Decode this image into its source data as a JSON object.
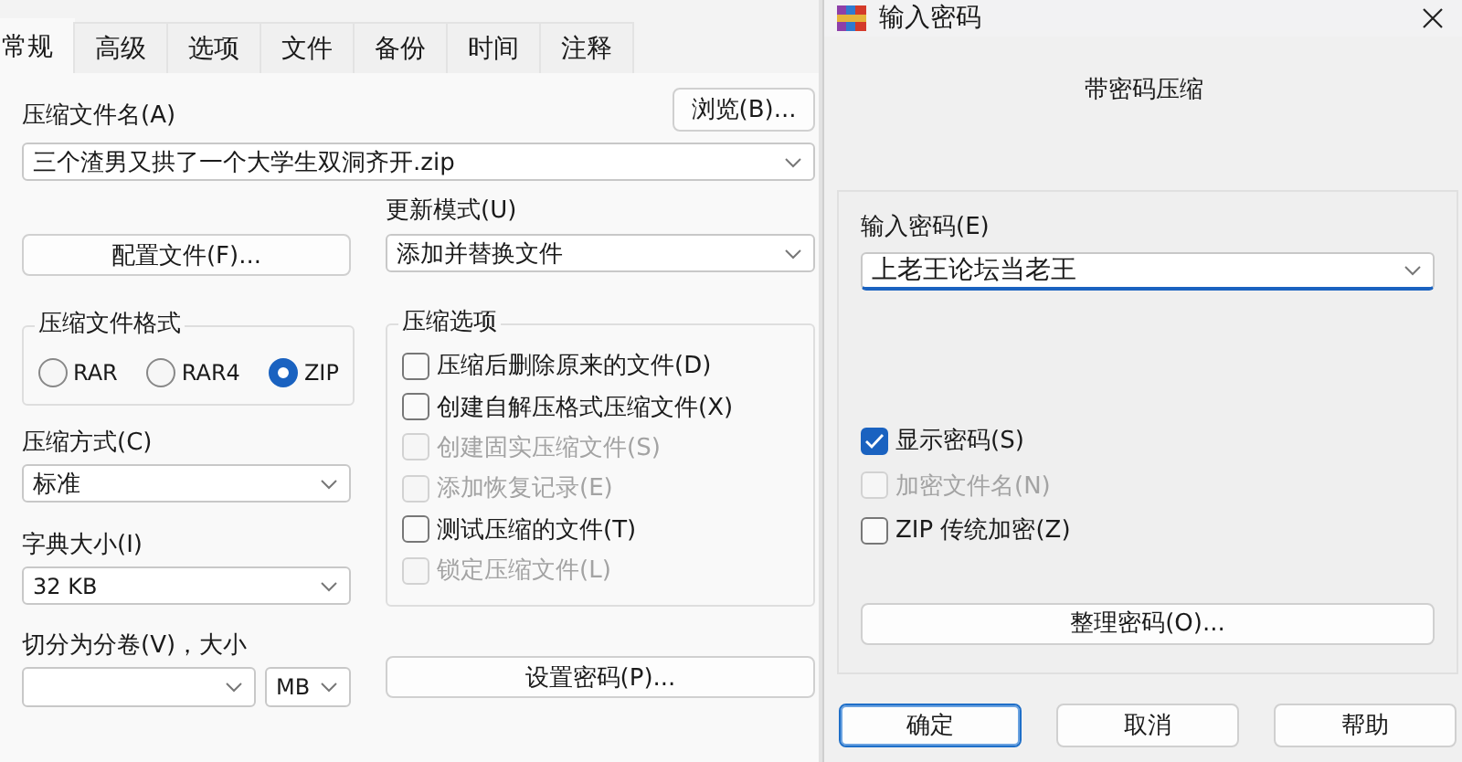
{
  "archive_dialog": {
    "tabs": [
      {
        "label": "常规",
        "selected": true
      },
      {
        "label": "高级",
        "selected": false
      },
      {
        "label": "选项",
        "selected": false
      },
      {
        "label": "文件",
        "selected": false
      },
      {
        "label": "备份",
        "selected": false
      },
      {
        "label": "时间",
        "selected": false
      },
      {
        "label": "注释",
        "selected": false
      }
    ],
    "archive_name": {
      "label": "压缩文件名(A)",
      "value": "三个渣男又拱了一个大学生双洞齐开.zip"
    },
    "browse_button": "浏览(B)...",
    "profiles_button": "配置文件(F)...",
    "update_mode": {
      "label": "更新模式(U)",
      "value": "添加并替换文件"
    },
    "archive_format": {
      "label": "压缩文件格式",
      "options": [
        {
          "label": "RAR",
          "selected": false
        },
        {
          "label": "RAR4",
          "selected": false
        },
        {
          "label": "ZIP",
          "selected": true
        }
      ]
    },
    "compression_method": {
      "label": "压缩方式(C)",
      "value": "标准"
    },
    "dictionary_size": {
      "label": "字典大小(I)",
      "value": "32 KB"
    },
    "split_volumes": {
      "label": "切分为分卷(V)，大小",
      "unit": "MB"
    },
    "archiving_options": {
      "label": "压缩选项",
      "options": [
        {
          "label": "压缩后删除原来的文件(D)",
          "checked": false,
          "disabled": false
        },
        {
          "label": "创建自解压格式压缩文件(X)",
          "checked": false,
          "disabled": false
        },
        {
          "label": "创建固实压缩文件(S)",
          "checked": false,
          "disabled": true
        },
        {
          "label": "添加恢复记录(E)",
          "checked": false,
          "disabled": true
        },
        {
          "label": "测试压缩的文件(T)",
          "checked": false,
          "disabled": false
        },
        {
          "label": "锁定压缩文件(L)",
          "checked": false,
          "disabled": true
        }
      ]
    },
    "set_password_button": "设置密码(P)..."
  },
  "password_dialog": {
    "title": "输入密码",
    "heading": "带密码压缩",
    "password": {
      "label": "输入密码(E)",
      "value": "上老王论坛当老王"
    },
    "options": [
      {
        "label": "显示密码(S)",
        "checked": true,
        "disabled": false
      },
      {
        "label": "加密文件名(N)",
        "checked": false,
        "disabled": true
      },
      {
        "label": "ZIP 传统加密(Z)",
        "checked": false,
        "disabled": false
      }
    ],
    "organize_button": "整理密码(O)...",
    "buttons": [
      {
        "label": "确定",
        "default": true
      },
      {
        "label": "取消",
        "default": false
      },
      {
        "label": "帮助",
        "default": false
      }
    ]
  }
}
